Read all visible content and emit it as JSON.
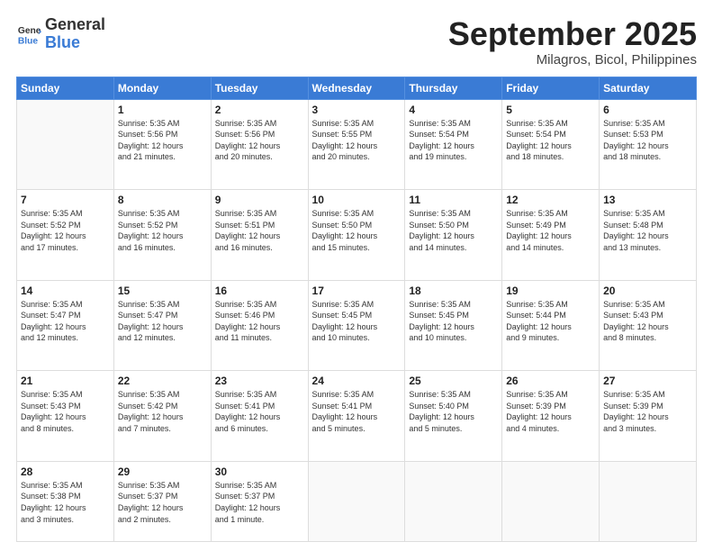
{
  "header": {
    "logo_general": "General",
    "logo_blue": "Blue",
    "month_title": "September 2025",
    "subtitle": "Milagros, Bicol, Philippines"
  },
  "days_of_week": [
    "Sunday",
    "Monday",
    "Tuesday",
    "Wednesday",
    "Thursday",
    "Friday",
    "Saturday"
  ],
  "weeks": [
    [
      {
        "day": "",
        "text": ""
      },
      {
        "day": "1",
        "text": "Sunrise: 5:35 AM\nSunset: 5:56 PM\nDaylight: 12 hours\nand 21 minutes."
      },
      {
        "day": "2",
        "text": "Sunrise: 5:35 AM\nSunset: 5:56 PM\nDaylight: 12 hours\nand 20 minutes."
      },
      {
        "day": "3",
        "text": "Sunrise: 5:35 AM\nSunset: 5:55 PM\nDaylight: 12 hours\nand 20 minutes."
      },
      {
        "day": "4",
        "text": "Sunrise: 5:35 AM\nSunset: 5:54 PM\nDaylight: 12 hours\nand 19 minutes."
      },
      {
        "day": "5",
        "text": "Sunrise: 5:35 AM\nSunset: 5:54 PM\nDaylight: 12 hours\nand 18 minutes."
      },
      {
        "day": "6",
        "text": "Sunrise: 5:35 AM\nSunset: 5:53 PM\nDaylight: 12 hours\nand 18 minutes."
      }
    ],
    [
      {
        "day": "7",
        "text": "Sunrise: 5:35 AM\nSunset: 5:52 PM\nDaylight: 12 hours\nand 17 minutes."
      },
      {
        "day": "8",
        "text": "Sunrise: 5:35 AM\nSunset: 5:52 PM\nDaylight: 12 hours\nand 16 minutes."
      },
      {
        "day": "9",
        "text": "Sunrise: 5:35 AM\nSunset: 5:51 PM\nDaylight: 12 hours\nand 16 minutes."
      },
      {
        "day": "10",
        "text": "Sunrise: 5:35 AM\nSunset: 5:50 PM\nDaylight: 12 hours\nand 15 minutes."
      },
      {
        "day": "11",
        "text": "Sunrise: 5:35 AM\nSunset: 5:50 PM\nDaylight: 12 hours\nand 14 minutes."
      },
      {
        "day": "12",
        "text": "Sunrise: 5:35 AM\nSunset: 5:49 PM\nDaylight: 12 hours\nand 14 minutes."
      },
      {
        "day": "13",
        "text": "Sunrise: 5:35 AM\nSunset: 5:48 PM\nDaylight: 12 hours\nand 13 minutes."
      }
    ],
    [
      {
        "day": "14",
        "text": "Sunrise: 5:35 AM\nSunset: 5:47 PM\nDaylight: 12 hours\nand 12 minutes."
      },
      {
        "day": "15",
        "text": "Sunrise: 5:35 AM\nSunset: 5:47 PM\nDaylight: 12 hours\nand 12 minutes."
      },
      {
        "day": "16",
        "text": "Sunrise: 5:35 AM\nSunset: 5:46 PM\nDaylight: 12 hours\nand 11 minutes."
      },
      {
        "day": "17",
        "text": "Sunrise: 5:35 AM\nSunset: 5:45 PM\nDaylight: 12 hours\nand 10 minutes."
      },
      {
        "day": "18",
        "text": "Sunrise: 5:35 AM\nSunset: 5:45 PM\nDaylight: 12 hours\nand 10 minutes."
      },
      {
        "day": "19",
        "text": "Sunrise: 5:35 AM\nSunset: 5:44 PM\nDaylight: 12 hours\nand 9 minutes."
      },
      {
        "day": "20",
        "text": "Sunrise: 5:35 AM\nSunset: 5:43 PM\nDaylight: 12 hours\nand 8 minutes."
      }
    ],
    [
      {
        "day": "21",
        "text": "Sunrise: 5:35 AM\nSunset: 5:43 PM\nDaylight: 12 hours\nand 8 minutes."
      },
      {
        "day": "22",
        "text": "Sunrise: 5:35 AM\nSunset: 5:42 PM\nDaylight: 12 hours\nand 7 minutes."
      },
      {
        "day": "23",
        "text": "Sunrise: 5:35 AM\nSunset: 5:41 PM\nDaylight: 12 hours\nand 6 minutes."
      },
      {
        "day": "24",
        "text": "Sunrise: 5:35 AM\nSunset: 5:41 PM\nDaylight: 12 hours\nand 5 minutes."
      },
      {
        "day": "25",
        "text": "Sunrise: 5:35 AM\nSunset: 5:40 PM\nDaylight: 12 hours\nand 5 minutes."
      },
      {
        "day": "26",
        "text": "Sunrise: 5:35 AM\nSunset: 5:39 PM\nDaylight: 12 hours\nand 4 minutes."
      },
      {
        "day": "27",
        "text": "Sunrise: 5:35 AM\nSunset: 5:39 PM\nDaylight: 12 hours\nand 3 minutes."
      }
    ],
    [
      {
        "day": "28",
        "text": "Sunrise: 5:35 AM\nSunset: 5:38 PM\nDaylight: 12 hours\nand 3 minutes."
      },
      {
        "day": "29",
        "text": "Sunrise: 5:35 AM\nSunset: 5:37 PM\nDaylight: 12 hours\nand 2 minutes."
      },
      {
        "day": "30",
        "text": "Sunrise: 5:35 AM\nSunset: 5:37 PM\nDaylight: 12 hours\nand 1 minute."
      },
      {
        "day": "",
        "text": ""
      },
      {
        "day": "",
        "text": ""
      },
      {
        "day": "",
        "text": ""
      },
      {
        "day": "",
        "text": ""
      }
    ]
  ]
}
